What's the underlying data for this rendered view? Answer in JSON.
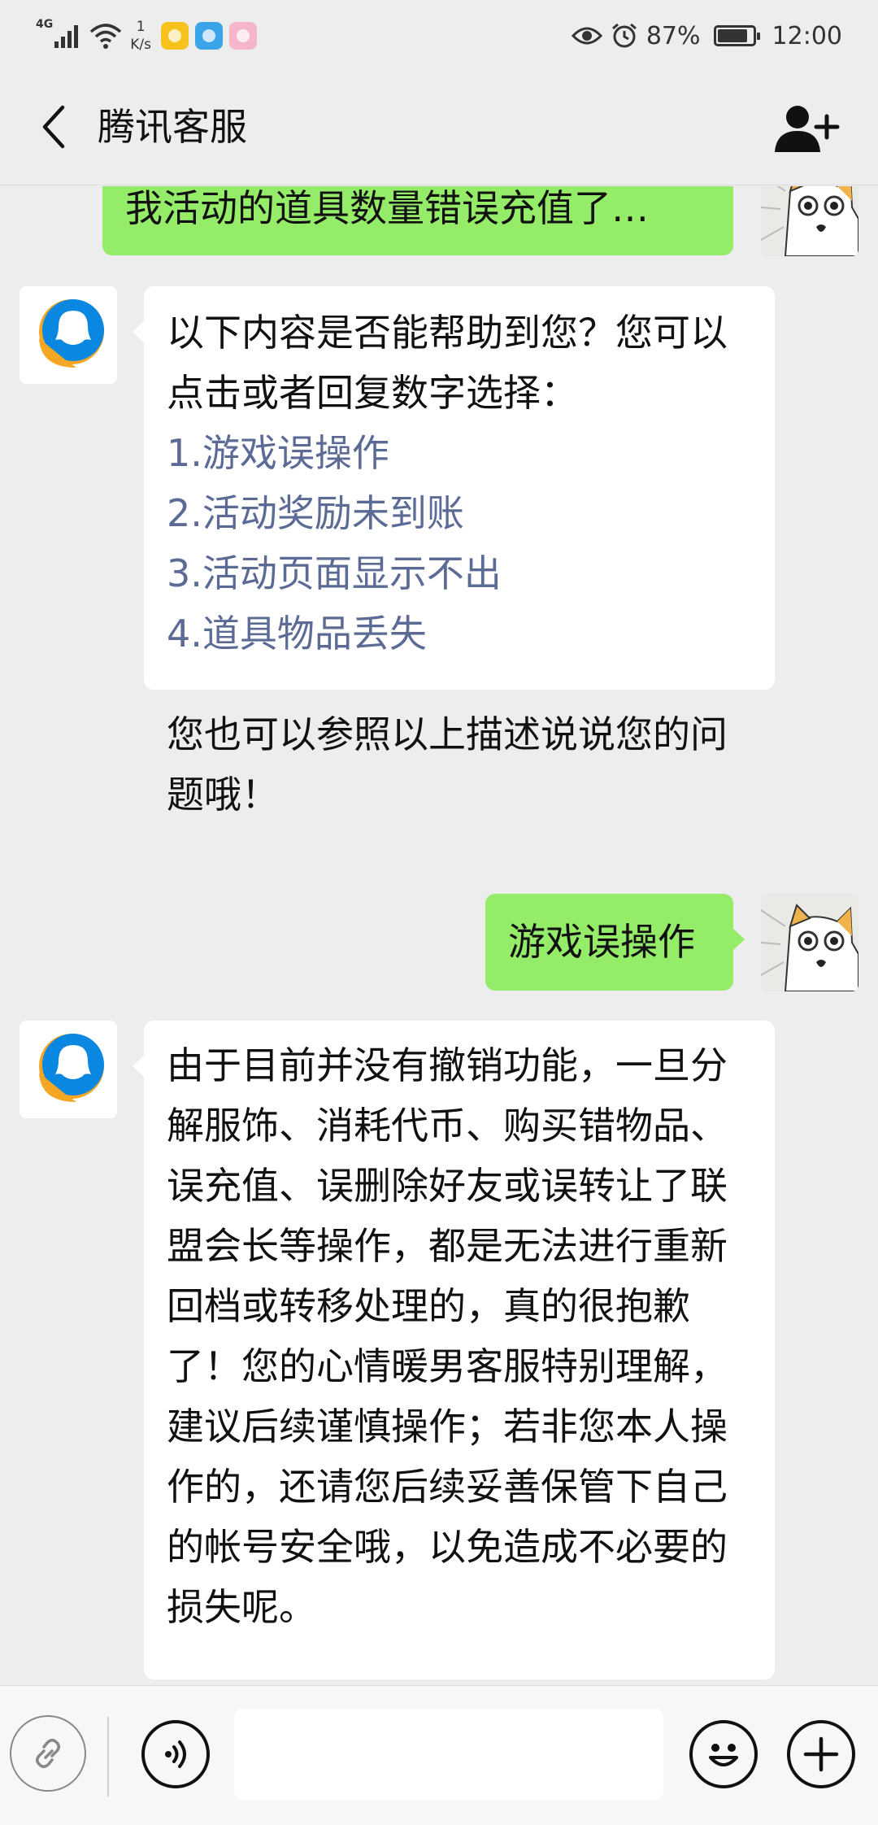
{
  "status_bar": {
    "network": "4G",
    "speed_value": "1",
    "speed_unit": "K/s",
    "battery": "87%",
    "battery_level": 0.87,
    "time": "12:00"
  },
  "nav": {
    "title": "腾讯客服"
  },
  "messages": [
    {
      "side": "out",
      "text": "我活动的道具数量错误充值了…"
    },
    {
      "side": "in",
      "intro": "以下内容是否能帮助到您？您可以点击或者回复数字选择：",
      "options": [
        "1.游戏误操作",
        "2.活动奖励未到账",
        "3.活动页面显示不出",
        "4.道具物品丢失"
      ],
      "outro": "您也可以参照以上描述说说您的问题哦！"
    },
    {
      "side": "out",
      "text": "游戏误操作"
    },
    {
      "side": "in",
      "text": "由于目前并没有撤销功能，一旦分解服饰、消耗代币、购买错物品、误充值、误删除好友或误转让了联盟会长等操作，都是无法进行重新回档或转移处理的，真的很抱歉了！您的心情暖男客服特别理解，建议后续谨慎操作；若非您本人操作的，还请您后续妥善保管下自己的帐号安全哦，以免造成不必要的损失呢。"
    }
  ],
  "colors": {
    "bubble_out": "#95ec69",
    "bubble_in": "#ffffff",
    "option_link": "#5b6b95",
    "background": "#ededed"
  },
  "icons": {
    "back": "chevron-left-icon",
    "add_friend": "add-person-icon",
    "link": "link-icon",
    "voice": "voice-icon",
    "emoji": "emoji-icon",
    "plus": "plus-icon"
  }
}
